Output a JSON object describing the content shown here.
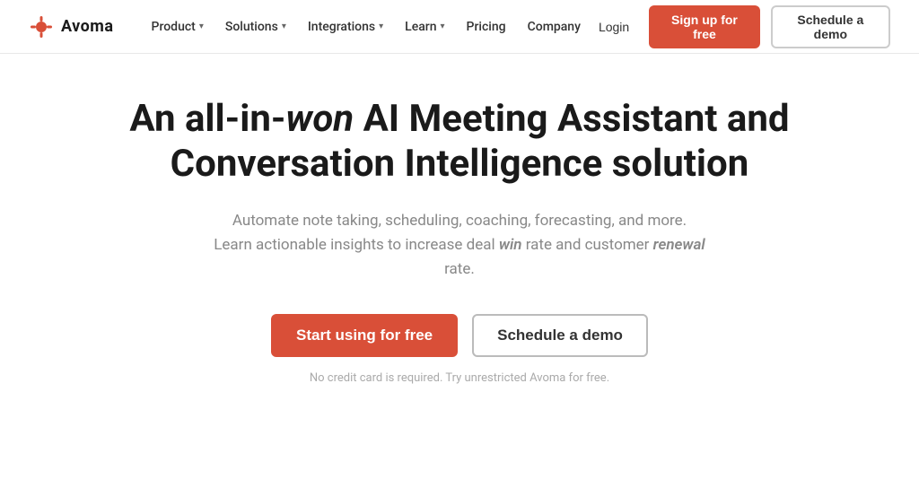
{
  "brand": {
    "name": "Avoma",
    "logo_alt": "Avoma logo"
  },
  "nav": {
    "items": [
      {
        "label": "Product",
        "has_dropdown": true
      },
      {
        "label": "Solutions",
        "has_dropdown": true
      },
      {
        "label": "Integrations",
        "has_dropdown": true
      },
      {
        "label": "Learn",
        "has_dropdown": true
      },
      {
        "label": "Pricing",
        "has_dropdown": false
      },
      {
        "label": "Company",
        "has_dropdown": false
      }
    ],
    "login_label": "Login",
    "signup_label": "Sign up for free",
    "demo_label": "Schedule a demo"
  },
  "hero": {
    "title_prefix": "An all-in-",
    "title_italic": "won",
    "title_suffix": " AI Meeting Assistant and Conversation Intelligence solution",
    "subtitle_line1": "Automate note taking, scheduling, coaching, forecasting, and more.",
    "subtitle_line2_prefix": "Learn actionable insights to increase deal ",
    "subtitle_italic1": "win",
    "subtitle_middle": " rate and customer ",
    "subtitle_italic2": "renewal",
    "subtitle_suffix": " rate.",
    "cta_start": "Start using for free",
    "cta_demo": "Schedule a demo",
    "no_credit": "No credit card is required. Try unrestricted Avoma for free."
  },
  "colors": {
    "brand_red": "#d94f38",
    "text_dark": "#1a1a1a",
    "text_muted": "#888888",
    "text_light": "#aaaaaa",
    "border": "#cccccc"
  }
}
